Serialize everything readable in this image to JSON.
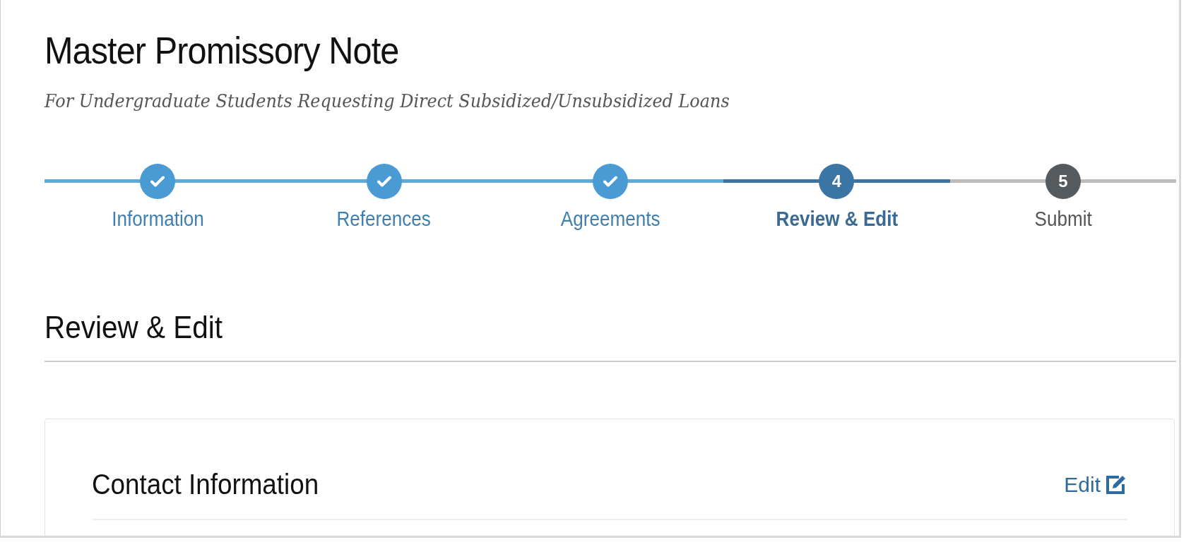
{
  "title": "Master Promissory Note",
  "subtitle": "For Undergraduate Students Requesting Direct Subsidized/Unsubsidized Loans",
  "steps": [
    {
      "label": "Information",
      "kind": "complete",
      "selected": false
    },
    {
      "label": "References",
      "kind": "complete",
      "selected": false
    },
    {
      "label": "Agreements",
      "kind": "complete",
      "selected": false
    },
    {
      "label": "Review & Edit",
      "number": "4",
      "kind": "current",
      "selected": true
    },
    {
      "label": "Submit",
      "number": "5",
      "kind": "upcoming",
      "selected": false
    }
  ],
  "section_heading": "Review & Edit",
  "card": {
    "title": "Contact Information",
    "edit_link": "Edit"
  }
}
